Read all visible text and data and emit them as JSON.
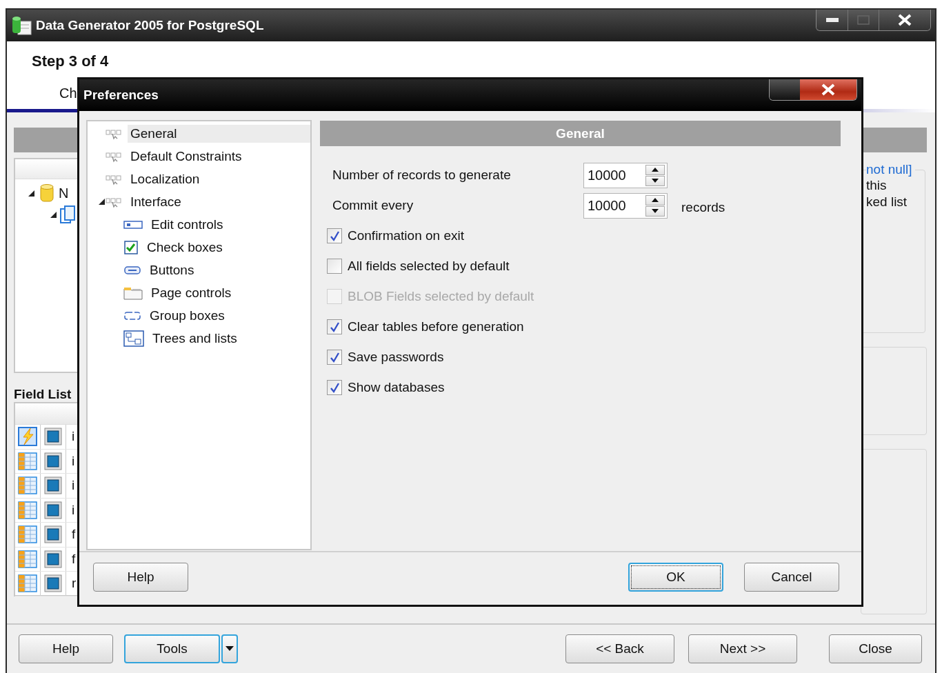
{
  "window": {
    "title": "Data Generator 2005 for PostgreSQL",
    "step": "Step 3 of 4",
    "subtitle": "Ch"
  },
  "left_panel": {
    "tree": [
      {
        "label": "N",
        "expanded": true
      }
    ],
    "field_list": {
      "title": "Field List",
      "rows": [
        {
          "kind": "trigger",
          "column_3": "i"
        },
        {
          "kind": "table",
          "column_3": "i"
        },
        {
          "kind": "table",
          "column_3": "i"
        },
        {
          "kind": "table",
          "column_3": "i"
        },
        {
          "kind": "table",
          "column_3": "f"
        },
        {
          "kind": "table",
          "column_3": "f"
        },
        {
          "kind": "table",
          "column_3": "r"
        }
      ]
    }
  },
  "right_panel": {
    "legend": "not null]",
    "lines": [
      "this",
      "ked list"
    ]
  },
  "footer_buttons": [
    {
      "label": "Help",
      "kind": "plain",
      "focused": false
    },
    {
      "label": "Tools",
      "kind": "split",
      "focused": true
    },
    {
      "label": "<< Back",
      "kind": "plain",
      "focused": false
    },
    {
      "label": "Next >>",
      "kind": "plain",
      "focused": false
    },
    {
      "label": "Close",
      "kind": "plain",
      "focused": false
    }
  ],
  "dialog": {
    "title": "Preferences",
    "tree": [
      {
        "label": "General",
        "selected": true
      },
      {
        "label": "Default Constraints",
        "selected": false
      },
      {
        "label": "Localization",
        "selected": false
      },
      {
        "label": "Interface",
        "selected": false,
        "expanded": true,
        "children": [
          {
            "label": "Edit controls",
            "kind": "edit",
            "selected": false
          },
          {
            "label": "Check boxes",
            "kind": "checkbox",
            "selected": false
          },
          {
            "label": "Buttons",
            "kind": "button",
            "selected": false
          },
          {
            "label": "Page controls",
            "kind": "page",
            "selected": false
          },
          {
            "label": "Group boxes",
            "kind": "group",
            "selected": false
          },
          {
            "label": "Trees and lists",
            "kind": "tree",
            "selected": false
          }
        ]
      }
    ],
    "section_title": "General",
    "fields": [
      {
        "label": "Number of records to generate",
        "value": "10000"
      },
      {
        "label": "Commit every",
        "value": "10000",
        "suffix": "records"
      }
    ],
    "options": [
      {
        "label": "Confirmation on exit",
        "checked": true,
        "disabled": false
      },
      {
        "label": "All fields selected by default",
        "checked": false,
        "disabled": false
      },
      {
        "label": "BLOB Fields selected by default",
        "checked": false,
        "disabled": true
      },
      {
        "label": "Clear tables before generation",
        "checked": true,
        "disabled": false
      },
      {
        "label": "Save passwords",
        "checked": true,
        "disabled": false
      },
      {
        "label": "Show databases",
        "checked": true,
        "disabled": false
      }
    ],
    "buttons": [
      {
        "label": "Help",
        "focused": false
      },
      {
        "label": "OK",
        "focused": true
      },
      {
        "label": "Cancel",
        "focused": false
      }
    ]
  }
}
